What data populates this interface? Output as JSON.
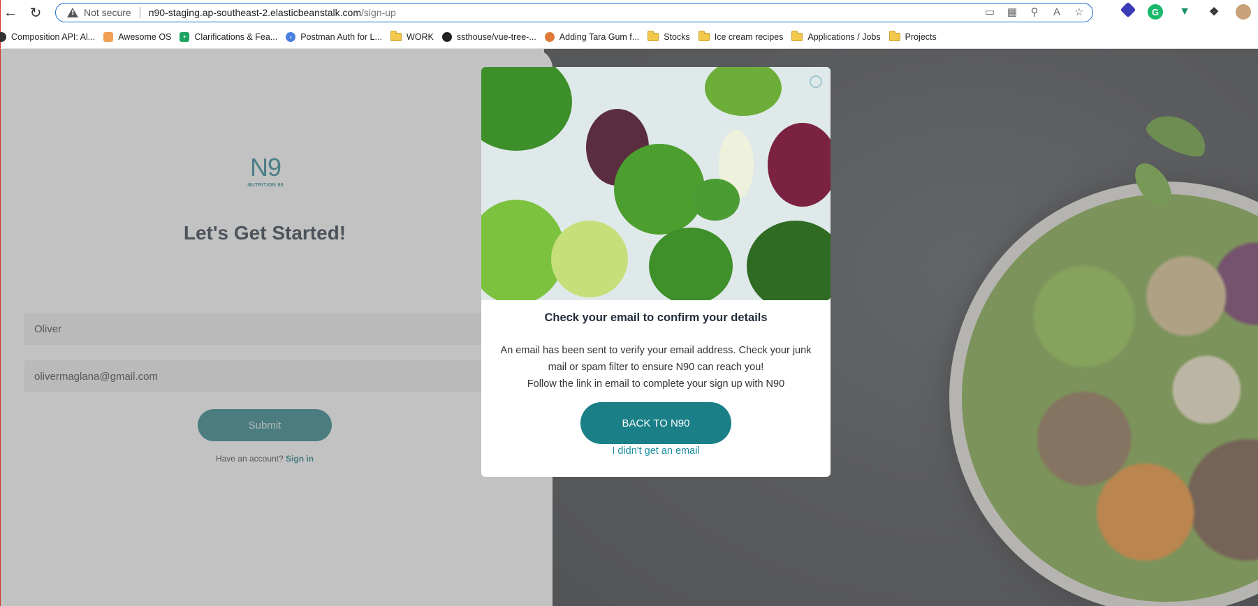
{
  "browser": {
    "not_secure": "Not secure",
    "url_host": "n90-staging.ap-southeast-2.elasticbeanstalk.com",
    "url_path": "/sign-up",
    "bookmarks": [
      {
        "label": "Composition API: Al...",
        "icon": "vue-icon"
      },
      {
        "label": "Awesome OS",
        "icon": "awesome-icon"
      },
      {
        "label": "Clarifications & Fea...",
        "icon": "sheets-icon"
      },
      {
        "label": "Postman Auth for L...",
        "icon": "postman-icon"
      },
      {
        "label": "WORK",
        "icon": "folder-icon"
      },
      {
        "label": "ssthouse/vue-tree-...",
        "icon": "github-icon"
      },
      {
        "label": "Adding Tara Gum f...",
        "icon": "site-icon"
      },
      {
        "label": "Stocks",
        "icon": "folder-icon"
      },
      {
        "label": "Ice cream recipes",
        "icon": "folder-icon"
      },
      {
        "label": "Applications / Jobs",
        "icon": "folder-icon"
      },
      {
        "label": "Projects",
        "icon": "folder-icon"
      }
    ]
  },
  "signup": {
    "logo_mark": "N9",
    "logo_sub": "NUTRITION 90",
    "headline": "Let's Get Started!",
    "name_value": "Oliver",
    "email_value": "olivermaglana@gmail.com",
    "submit_label": "Submit",
    "have_account": "Have an account?",
    "sign_in": "Sign in"
  },
  "modal": {
    "title": "Check your email to confirm your details",
    "body_line1": "An email has been sent to verify your email address. Check your junk",
    "body_line2": "mail or spam filter to ensure N90 can reach you!",
    "body_line3": "Follow the link in email to complete your sign up with N90",
    "back_button": "BACK TO N90",
    "no_email_link": "I didn't get an email"
  },
  "colors": {
    "brand_teal": "#1b7f87",
    "link_blue": "#1b8ea0"
  }
}
